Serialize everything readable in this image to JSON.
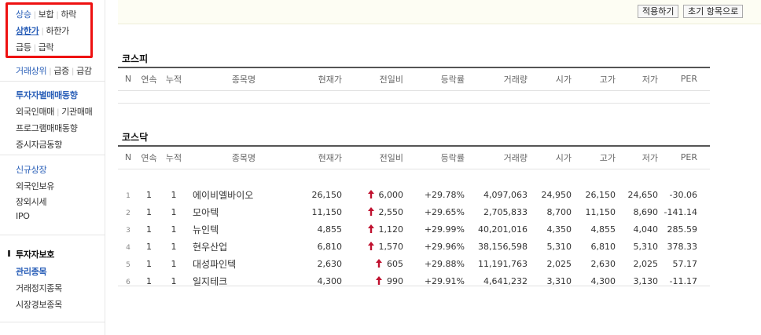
{
  "sidebar": {
    "row1": [
      "상승",
      "보합",
      "하락"
    ],
    "row2": [
      "상한가",
      "하한가"
    ],
    "row3": [
      "급등",
      "급락"
    ],
    "row4": [
      "거래상위",
      "급증",
      "급감"
    ],
    "investor_title": "투자자별매매동향",
    "row6": [
      "외국인매매",
      "기관매매"
    ],
    "program": "프로그램매매동향",
    "deposit": "증시자금동향",
    "newlist": "신규상장",
    "foreign": "외국인보유",
    "offmarket": "장외시세",
    "ipo": "IPO",
    "protect_title": "투자자보호",
    "managed": "관리종목",
    "halted": "거래정지종목",
    "warning": "시장경보종목"
  },
  "toolbar": {
    "apply": "적용하기",
    "reset": "초기 항목으로"
  },
  "columns": [
    "N",
    "연속",
    "누적",
    "종목명",
    "현재가",
    "전일비",
    "등락률",
    "거래량",
    "시가",
    "고가",
    "저가",
    "PER"
  ],
  "kospi": {
    "title": "코스피",
    "rows": []
  },
  "kosdaq": {
    "title": "코스닥",
    "rows": [
      [
        "1",
        "1",
        "1",
        "에이비엘바이오",
        "26,150",
        "6,000",
        "+29.78%",
        "4,097,063",
        "24,950",
        "26,150",
        "24,650",
        "-30.06"
      ],
      [
        "2",
        "1",
        "1",
        "모아텍",
        "11,150",
        "2,550",
        "+29.65%",
        "2,705,833",
        "8,700",
        "11,150",
        "8,690",
        "-141.14"
      ],
      [
        "3",
        "1",
        "1",
        "뉴인텍",
        "4,855",
        "1,120",
        "+29.99%",
        "40,201,016",
        "4,350",
        "4,855",
        "4,040",
        "285.59"
      ],
      [
        "4",
        "1",
        "1",
        "현우산업",
        "6,810",
        "1,570",
        "+29.96%",
        "38,156,598",
        "5,310",
        "6,810",
        "5,310",
        "378.33"
      ],
      [
        "5",
        "1",
        "1",
        "대성파인텍",
        "2,630",
        "605",
        "+29.88%",
        "11,191,763",
        "2,025",
        "2,630",
        "2,025",
        "57.17"
      ],
      [
        "6",
        "1",
        "1",
        "일지테크",
        "4,300",
        "990",
        "+29.91%",
        "4,641,232",
        "3,310",
        "4,300",
        "3,130",
        "-11.17"
      ]
    ]
  },
  "colors": {
    "up": "#c0112f",
    "link": "#2a5fb8",
    "highlight_box": "#ee1111"
  },
  "icons": {
    "change_arrow": "up-arrow-icon"
  }
}
